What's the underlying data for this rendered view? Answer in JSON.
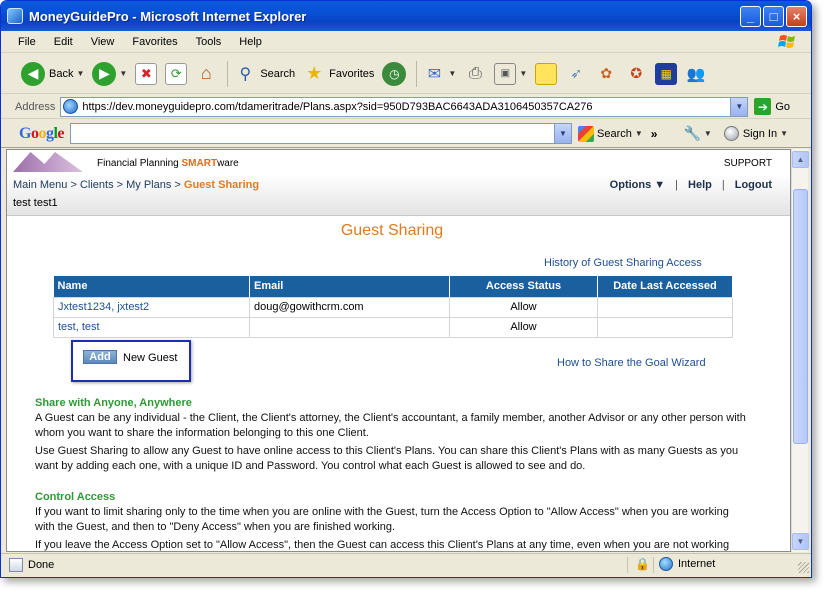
{
  "window": {
    "title": "MoneyGuidePro - Microsoft Internet Explorer"
  },
  "menu": [
    "File",
    "Edit",
    "View",
    "Favorites",
    "Tools",
    "Help"
  ],
  "toolbar": {
    "back_label": "Back",
    "search_label": "Search",
    "favorites_label": "Favorites"
  },
  "address": {
    "label": "Address",
    "url": "https://dev.moneyguidepro.com/tdameritrade/Plans.aspx?sid=950D793BAC6643ADA3106450357CA276",
    "go_label": "Go"
  },
  "google": {
    "logo": "Google",
    "search_label": "Search",
    "more": "»",
    "signin_label": "Sign In"
  },
  "page": {
    "tagline_prefix": "Financial Planning ",
    "tagline_smart": "SMART",
    "tagline_suffix": "ware",
    "support": "SUPPORT",
    "breadcrumb": {
      "path": "Main Menu > Clients > My Plans > ",
      "current": "Guest Sharing"
    },
    "client_name": "test test1",
    "nav": {
      "options": "Options ▼",
      "help": "Help",
      "logout": "Logout"
    },
    "title": "Guest Sharing",
    "history_link": "History of Guest Sharing Access",
    "table": {
      "headers": [
        "Name",
        "Email",
        "Access Status",
        "Date Last Accessed"
      ],
      "rows": [
        {
          "name": "Jxtest1234, jxtest2",
          "email": "doug@gowithcrm.com",
          "status": "Allow",
          "date": ""
        },
        {
          "name": "test, test",
          "email": "",
          "status": "Allow",
          "date": ""
        }
      ]
    },
    "add_button": "Add",
    "add_label": "New Guest",
    "wizard_link": "How to Share the Goal Wizard",
    "section1": {
      "heading": "Share with Anyone, Anywhere",
      "p1": "A Guest can be any individual - the Client, the Client's attorney, the Client's accountant, a family member, another Advisor or any other person with whom you want to share the information belonging to this one Client.",
      "p2": "Use Guest Sharing to allow any Guest to have online access to this Client's Plans. You can share this Client's Plans with as many Guests as you want by adding each one, with a unique ID and Password. You control what each Guest is allowed to see and do."
    },
    "section2": {
      "heading": "Control Access",
      "p1": "If you want to limit sharing only to the time when you are online with the Guest, turn the Access Option to \"Allow Access\" when you are working with the Guest, and then to \"Deny Access\" when you are finished working.",
      "p2": "If you leave the Access Option set to \"Allow Access\", then the Guest can access this Client's Plans at any time, even when you are not working"
    }
  },
  "status": {
    "text": "Done",
    "zone": "Internet"
  }
}
